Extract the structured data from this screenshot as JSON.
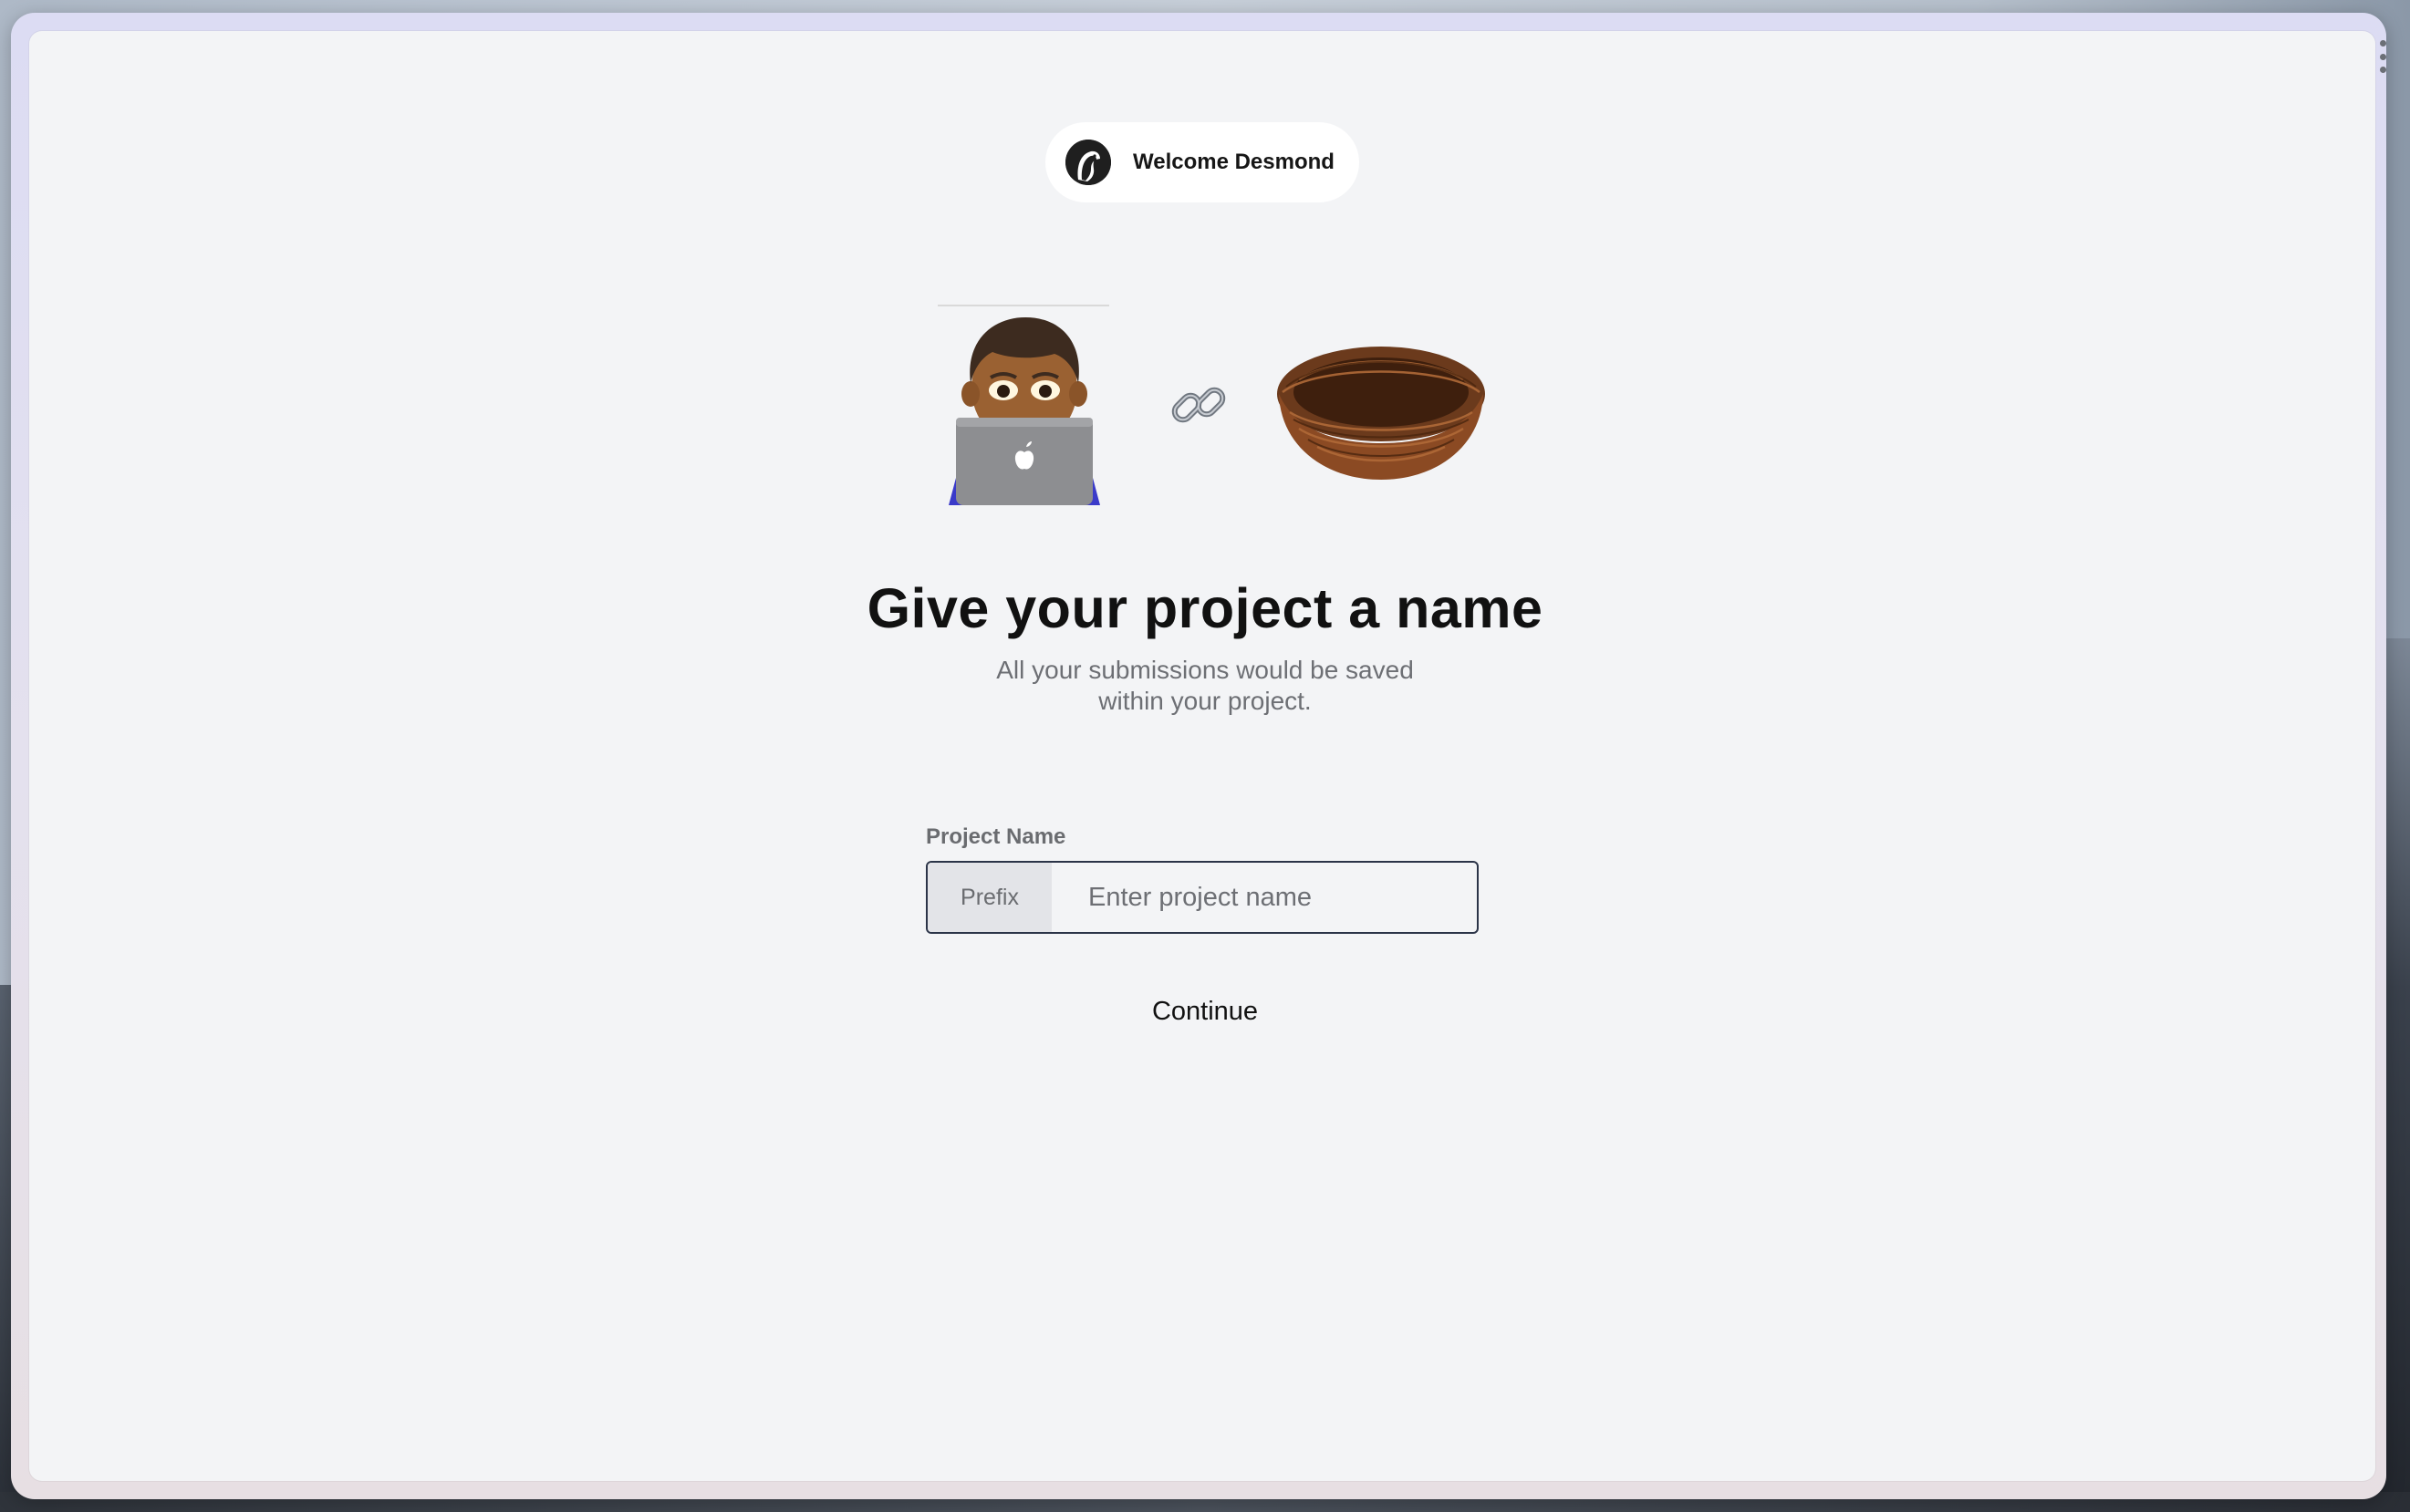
{
  "welcome": {
    "text": "Welcome Desmond",
    "avatar_icon": "bird-logo-icon"
  },
  "illustration": {
    "icons": [
      "technologist-with-laptop-icon",
      "link-chain-icon",
      "nest-icon"
    ]
  },
  "heading": {
    "title": "Give your project a name",
    "subtitle_line1": "All your submissions would be saved",
    "subtitle_line2": "within your project."
  },
  "form": {
    "label": "Project Name",
    "prefix": "Prefix",
    "placeholder": "Enter project name",
    "value": ""
  },
  "actions": {
    "continue_label": "Continue"
  },
  "colors": {
    "panel_bg": "#f3f4f6",
    "input_border": "#2b3448",
    "prefix_bg": "#e3e4e8",
    "muted_text": "#6d6f74"
  }
}
